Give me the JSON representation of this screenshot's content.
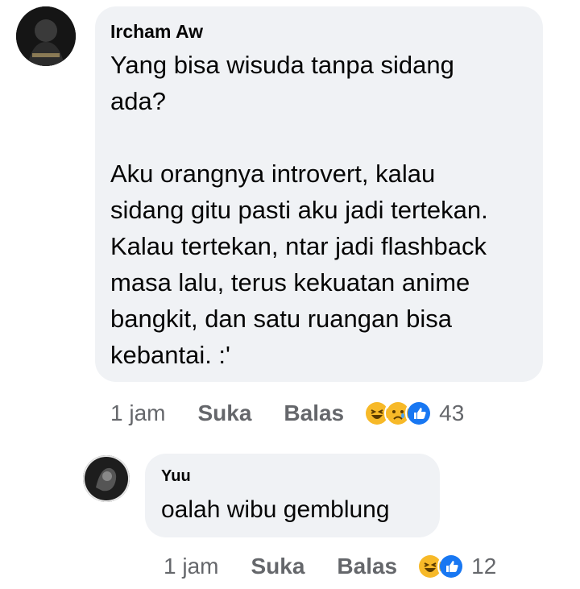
{
  "comment": {
    "author": "Ircham Aw",
    "text": "Yang bisa wisuda tanpa sidang\nada?\n\nAku orangnya introvert, kalau\nsidang gitu pasti aku jadi tertekan.\nKalau tertekan, ntar jadi flashback\nmasa lalu, terus kekuatan anime\nbangkit, dan satu ruangan bisa\nkebantai. :'",
    "time": "1 jam",
    "like_label": "Suka",
    "reply_label": "Balas",
    "reactions": [
      "haha-icon",
      "sad-icon",
      "like-icon"
    ],
    "reaction_count": "43"
  },
  "reply": {
    "author": "Yuu",
    "text": "oalah wibu gemblung",
    "time": "1 jam",
    "like_label": "Suka",
    "reply_label": "Balas",
    "reactions": [
      "haha-icon",
      "like-icon"
    ],
    "reaction_count": "12"
  },
  "colors": {
    "bubble": "#f0f2f5",
    "meta_text": "#65676b",
    "haha": "#f7b928",
    "like": "#1877f2"
  }
}
